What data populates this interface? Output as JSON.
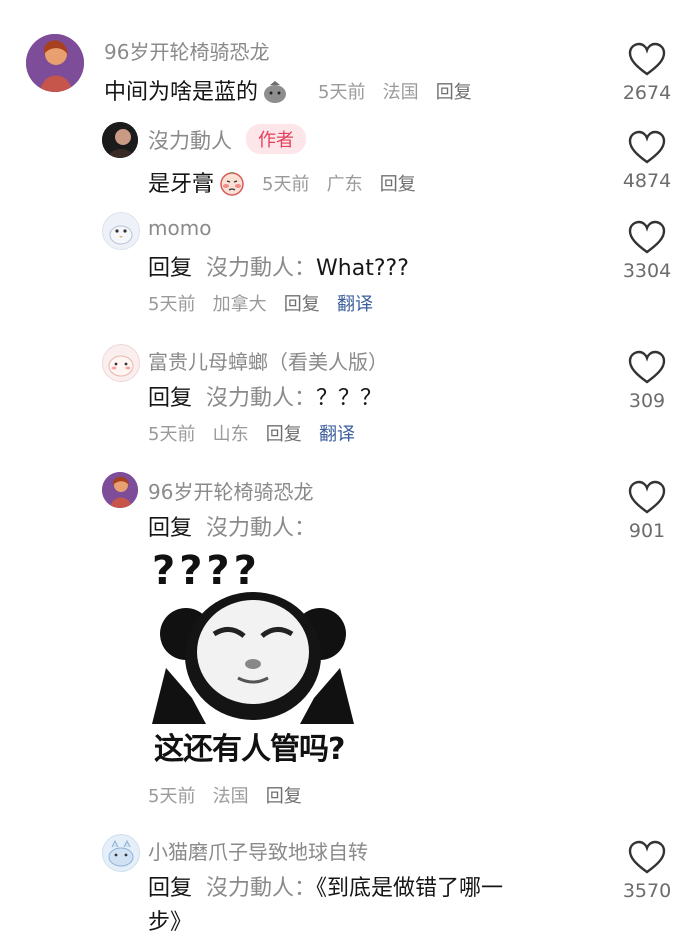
{
  "comments": [
    {
      "user": "96岁开轮椅骑恐龙",
      "text": "中间为啥是蓝的",
      "time": "5天前",
      "location": "法国",
      "reply_label": "回复",
      "likes": "2674"
    },
    {
      "user": "沒力動人",
      "author_tag": "作者",
      "text": "是牙膏",
      "time": "5天前",
      "location": "广东",
      "reply_label": "回复",
      "likes": "4874"
    },
    {
      "user": "momo",
      "reply_prefix": "回复",
      "reply_target": "沒力動人：",
      "text": "What???",
      "time": "5天前",
      "location": "加拿大",
      "reply_label": "回复",
      "translate_label": "翻译",
      "likes": "3304"
    },
    {
      "user": "富贵儿母蟑螂（看美人版）",
      "reply_prefix": "回复",
      "reply_target": "沒力動人：",
      "text": "？？？",
      "time": "5天前",
      "location": "山东",
      "reply_label": "回复",
      "translate_label": "翻译",
      "likes": "309"
    },
    {
      "user": "96岁开轮椅骑恐龙",
      "reply_prefix": "回复",
      "reply_target": "沒力動人：",
      "meme_question": "????",
      "meme_caption": "这还有人管吗?",
      "time": "5天前",
      "location": "法国",
      "reply_label": "回复",
      "likes": "901"
    },
    {
      "user": "小猫磨爪子导致地球自转",
      "reply_prefix": "回复",
      "reply_target": "沒力動人：",
      "text_line1": "《到底是做错了哪一",
      "text_line2": "步》",
      "likes": "3570"
    }
  ],
  "colors": {
    "heart_outline": "#333333",
    "author_tag_bg": "#fde6ea",
    "author_tag_text": "#e2415c",
    "translate_link": "#3b5e9c"
  },
  "icons": [
    "heart-icon",
    "dumpling-emoji-icon",
    "blushing-face-emoji-icon"
  ]
}
